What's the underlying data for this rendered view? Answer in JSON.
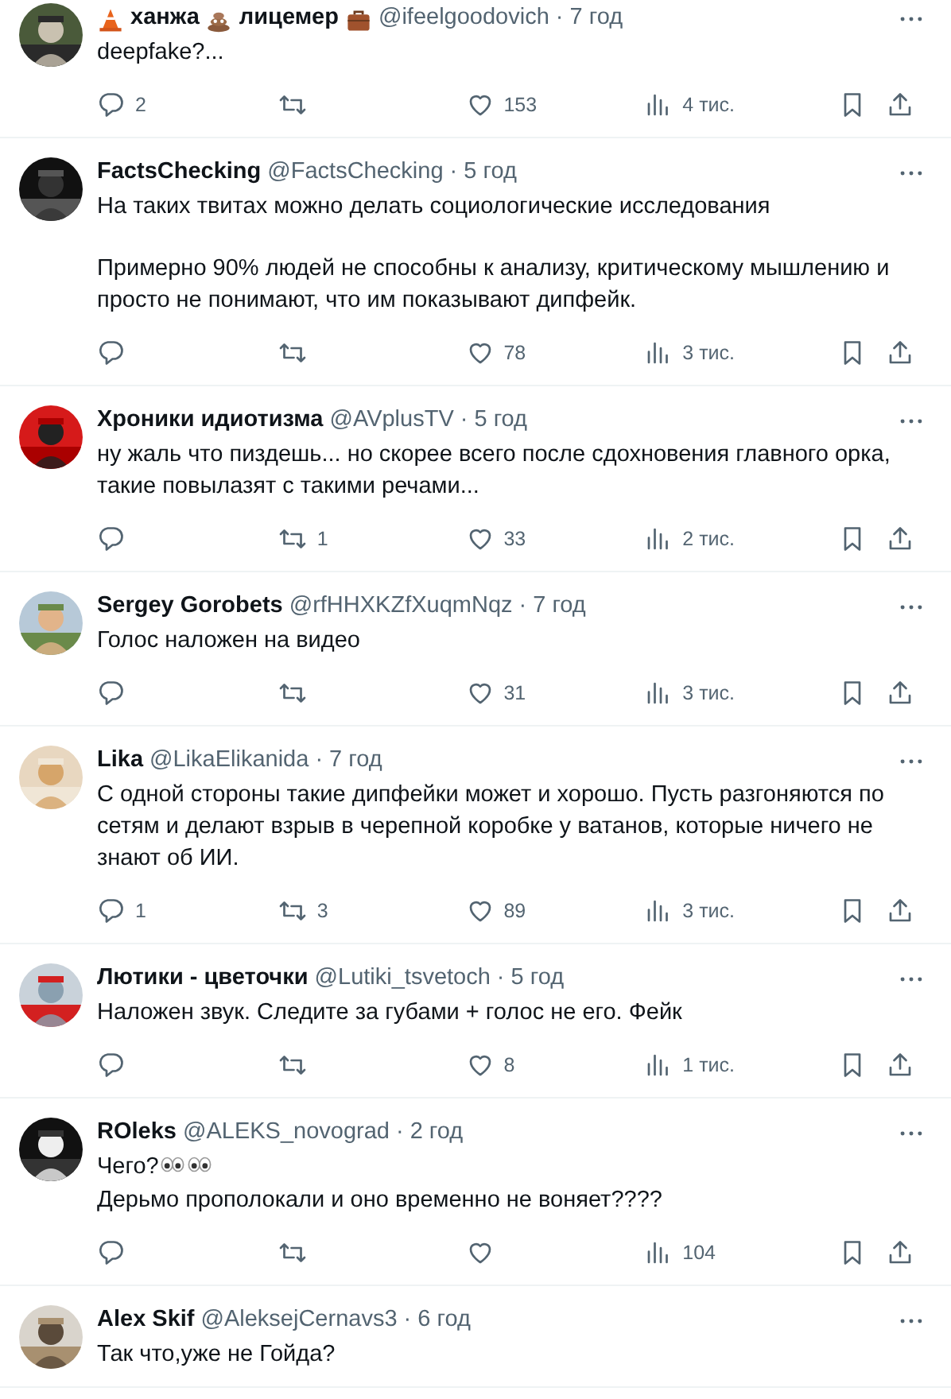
{
  "tweets": [
    {
      "name_parts": [
        {
          "kind": "cone"
        },
        {
          "kind": "text",
          "text": "ханжа"
        },
        {
          "kind": "poop"
        },
        {
          "kind": "text",
          "text": "лицемер"
        },
        {
          "kind": "briefcase"
        }
      ],
      "handle": "@ifeelgoodovich",
      "time": "· 7 год",
      "avatar": {
        "kind": "picture"
      },
      "paragraphs": [
        {
          "lines": [
            {
              "text": "deepfake?..."
            }
          ]
        }
      ],
      "replies": "2",
      "likes": "153",
      "views": "4 тис."
    },
    {
      "name_parts": [
        {
          "kind": "text",
          "text": "FactsChecking"
        }
      ],
      "handle": "@FactsChecking",
      "time": "· 5 год",
      "avatar": {
        "kind": "picture"
      },
      "paragraphs": [
        {
          "lines": [
            {
              "text": "На таких твитах можно делать социологические исследования"
            }
          ]
        },
        {
          "lines": [
            {
              "text": "Примерно 90% людей не способны к анализу, критическому мышлению и просто не понимают, что им показывают дипфейк."
            }
          ]
        }
      ],
      "likes": "78",
      "views": "3 тис."
    },
    {
      "name_parts": [
        {
          "kind": "text",
          "text": "Хроники идиотизма"
        }
      ],
      "handle": "@AVplusTV",
      "time": "· 5 год",
      "avatar": {
        "kind": "picture"
      },
      "paragraphs": [
        {
          "lines": [
            {
              "text": "ну жаль что пиздешь... но скорее всего после сдохновения главного орка, такие повылазят с такими речами..."
            }
          ]
        }
      ],
      "retweets": "1",
      "likes": "33",
      "views": "2 тис."
    },
    {
      "name_parts": [
        {
          "kind": "text",
          "text": "Sergey Gorobets"
        }
      ],
      "handle": "@rfHHXKZfXuqmNqz",
      "time": "· 7 год",
      "avatar": {
        "kind": "picture"
      },
      "paragraphs": [
        {
          "lines": [
            {
              "text": "Голос наложен на видео"
            }
          ]
        }
      ],
      "likes": "31",
      "views": "3 тис."
    },
    {
      "name_parts": [
        {
          "kind": "text",
          "text": "Lika"
        }
      ],
      "handle": "@LikaElikanida",
      "time": "· 7 год",
      "avatar": {
        "kind": "picture"
      },
      "paragraphs": [
        {
          "lines": [
            {
              "text": "С одной стороны такие дипфейки может и хорошо. Пусть разгоняются по сетям и делают взрыв в черепной коробке у ватанов, которые ничего не знают об ИИ."
            }
          ]
        }
      ],
      "replies": "1",
      "retweets": "3",
      "likes": "89",
      "views": "3 тис."
    },
    {
      "name_parts": [
        {
          "kind": "text",
          "text": "Лютики - цветочки"
        }
      ],
      "handle": "@Lutiki_tsvetoch",
      "time": "· 5 год",
      "avatar": {
        "kind": "picture"
      },
      "paragraphs": [
        {
          "lines": [
            {
              "text": "Наложен звук. Следите за губами + голос не его. Фейк"
            }
          ]
        }
      ],
      "likes": "8",
      "views": "1 тис."
    },
    {
      "name_parts": [
        {
          "kind": "text",
          "text": "ROleks"
        }
      ],
      "handle": "@ALEKS_novograd",
      "time": "· 2 год",
      "avatar": {
        "kind": "picture"
      },
      "paragraphs": [
        {
          "lines": [
            {
              "text": "Чего?",
              "trail": [
                {
                  "kind": "eyes"
                },
                {
                  "kind": "eyes"
                }
              ]
            },
            {
              "text": "Дерьмо прополокали и оно временно не воняет????"
            }
          ]
        }
      ],
      "views": "104"
    },
    {
      "name_parts": [
        {
          "kind": "text",
          "text": "Alex Skif"
        }
      ],
      "handle": "@AleksejCernavs3",
      "time": "· 6 год",
      "avatar": {
        "kind": "picture"
      },
      "paragraphs": [
        {
          "lines": [
            {
              "text": "Так что,уже не Гойда?"
            }
          ]
        }
      ]
    }
  ]
}
